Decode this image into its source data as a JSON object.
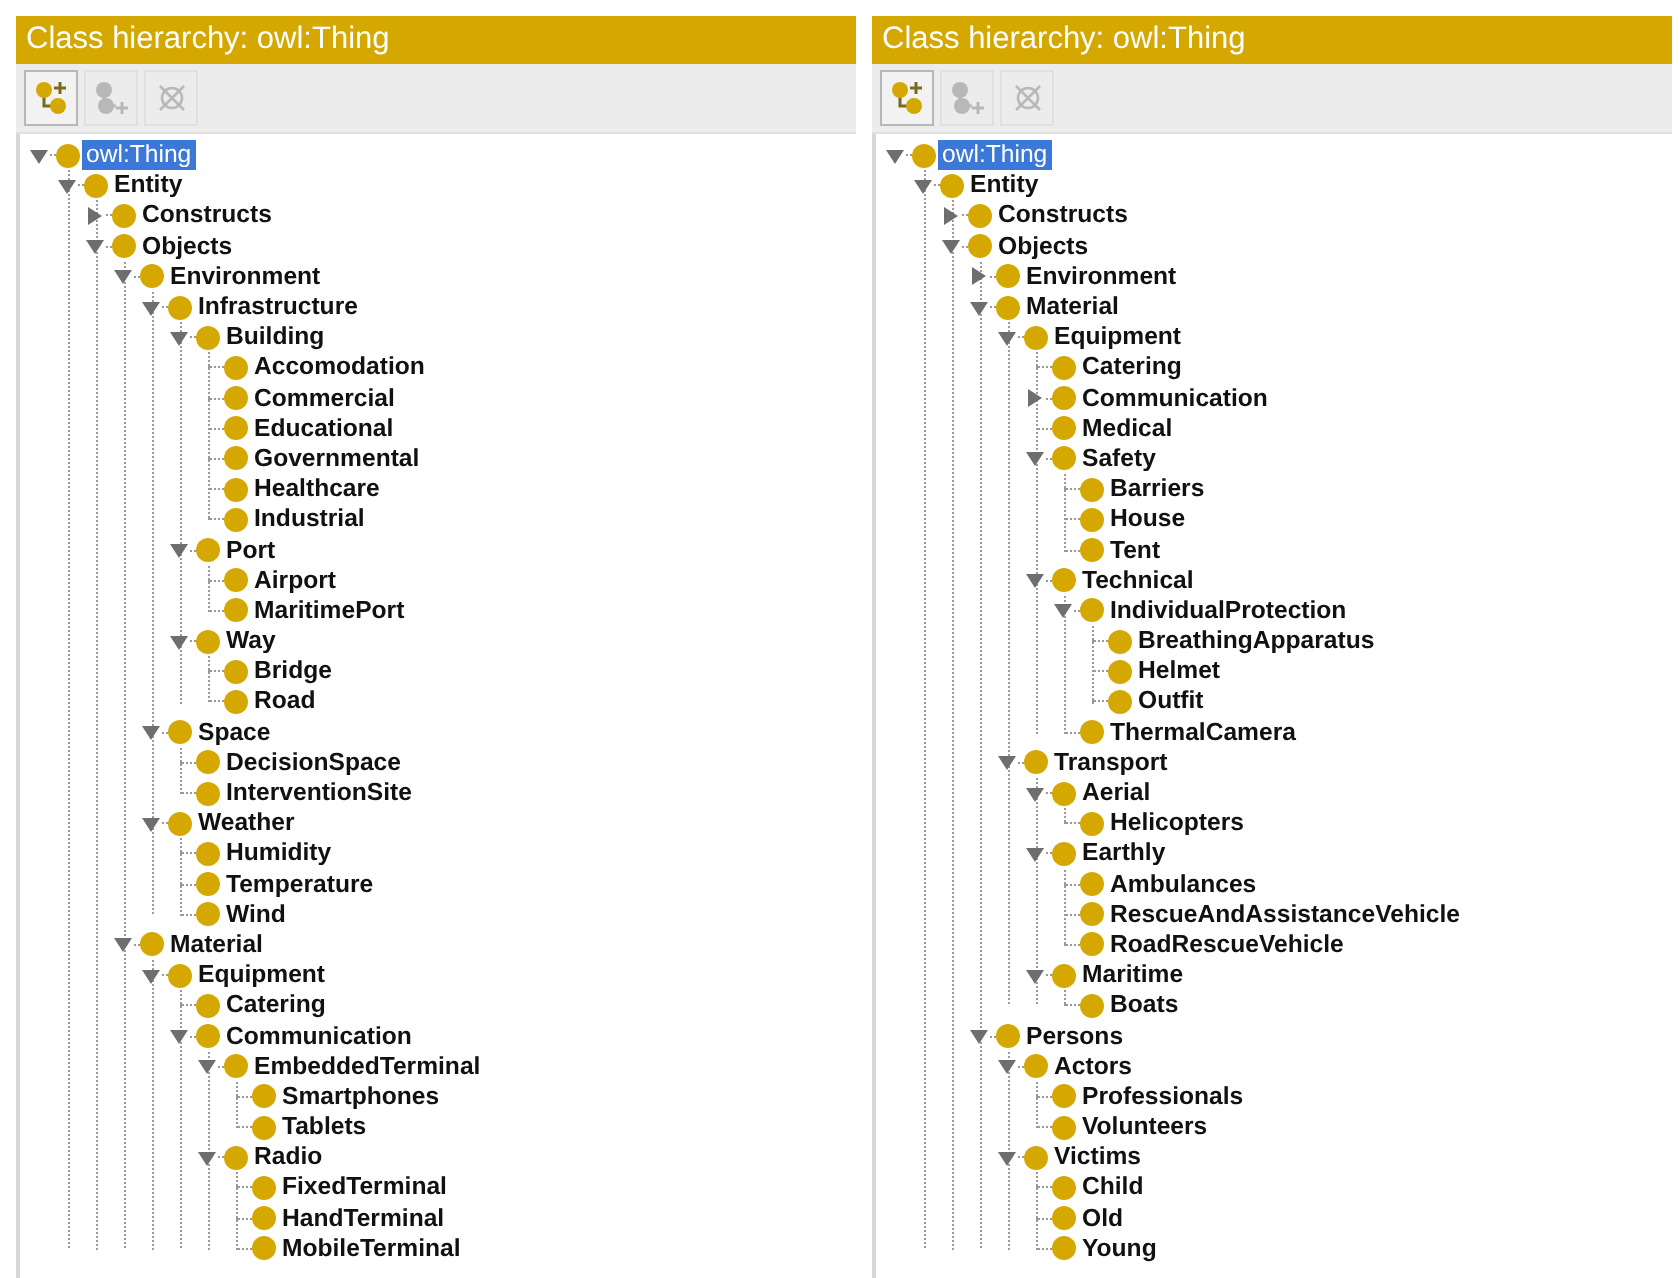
{
  "panels": [
    {
      "title": "Class hierarchy: owl:Thing",
      "toolbar": [
        {
          "kind": "add-subclass",
          "disabled": false
        },
        {
          "kind": "add-sibling",
          "disabled": true
        },
        {
          "kind": "delete",
          "disabled": true
        }
      ],
      "tree": {
        "label": "owl:Thing",
        "kind": "branch",
        "expanded": true,
        "selected": true,
        "children": [
          {
            "label": "Entity",
            "kind": "branch",
            "expanded": true,
            "selected": false,
            "children": [
              {
                "label": "Constructs",
                "kind": "branch",
                "expanded": false,
                "selected": false
              },
              {
                "label": "Objects",
                "kind": "branch",
                "expanded": true,
                "selected": false,
                "children": [
                  {
                    "label": "Environment",
                    "kind": "branch",
                    "expanded": true,
                    "selected": false,
                    "children": [
                      {
                        "label": "Infrastructure",
                        "kind": "branch",
                        "expanded": true,
                        "selected": false,
                        "children": [
                          {
                            "label": "Building",
                            "kind": "branch",
                            "expanded": true,
                            "selected": false,
                            "children": [
                              {
                                "label": "Accomodation",
                                "kind": "leaf",
                                "selected": false
                              },
                              {
                                "label": "Commercial",
                                "kind": "leaf",
                                "selected": false
                              },
                              {
                                "label": "Educational",
                                "kind": "leaf",
                                "selected": false
                              },
                              {
                                "label": "Governmental",
                                "kind": "leaf",
                                "selected": false
                              },
                              {
                                "label": "Healthcare",
                                "kind": "leaf",
                                "selected": false
                              },
                              {
                                "label": "Industrial",
                                "kind": "leaf",
                                "selected": false
                              }
                            ]
                          },
                          {
                            "label": "Port",
                            "kind": "branch",
                            "expanded": true,
                            "selected": false,
                            "children": [
                              {
                                "label": "Airport",
                                "kind": "leaf",
                                "selected": false
                              },
                              {
                                "label": "MaritimePort",
                                "kind": "leaf",
                                "selected": false
                              }
                            ]
                          },
                          {
                            "label": "Way",
                            "kind": "branch",
                            "expanded": true,
                            "selected": false,
                            "children": [
                              {
                                "label": "Bridge",
                                "kind": "leaf",
                                "selected": false
                              },
                              {
                                "label": "Road",
                                "kind": "leaf",
                                "selected": false
                              }
                            ]
                          }
                        ]
                      },
                      {
                        "label": "Space",
                        "kind": "branch",
                        "expanded": true,
                        "selected": false,
                        "children": [
                          {
                            "label": "DecisionSpace",
                            "kind": "leaf",
                            "selected": false
                          },
                          {
                            "label": "InterventionSite",
                            "kind": "leaf",
                            "selected": false
                          }
                        ]
                      },
                      {
                        "label": "Weather",
                        "kind": "branch",
                        "expanded": true,
                        "selected": false,
                        "children": [
                          {
                            "label": "Humidity",
                            "kind": "leaf",
                            "selected": false
                          },
                          {
                            "label": "Temperature",
                            "kind": "leaf",
                            "selected": false
                          },
                          {
                            "label": "Wind",
                            "kind": "leaf",
                            "selected": false
                          }
                        ]
                      }
                    ]
                  },
                  {
                    "label": "Material",
                    "kind": "branch",
                    "expanded": true,
                    "selected": false,
                    "children": [
                      {
                        "label": "Equipment",
                        "kind": "branch",
                        "expanded": true,
                        "selected": false,
                        "children": [
                          {
                            "label": "Catering",
                            "kind": "leaf",
                            "selected": false
                          },
                          {
                            "label": "Communication",
                            "kind": "branch",
                            "expanded": true,
                            "selected": false,
                            "children": [
                              {
                                "label": "EmbeddedTerminal",
                                "kind": "branch",
                                "expanded": true,
                                "selected": false,
                                "children": [
                                  {
                                    "label": "Smartphones",
                                    "kind": "leaf",
                                    "selected": false
                                  },
                                  {
                                    "label": "Tablets",
                                    "kind": "leaf",
                                    "selected": false
                                  }
                                ]
                              },
                              {
                                "label": "Radio",
                                "kind": "branch",
                                "expanded": true,
                                "selected": false,
                                "children": [
                                  {
                                    "label": "FixedTerminal",
                                    "kind": "leaf",
                                    "selected": false
                                  },
                                  {
                                    "label": "HandTerminal",
                                    "kind": "leaf",
                                    "selected": false
                                  },
                                  {
                                    "label": "MobileTerminal",
                                    "kind": "leaf",
                                    "selected": false
                                  }
                                ]
                              }
                            ]
                          }
                        ]
                      }
                    ]
                  }
                ]
              }
            ]
          }
        ]
      }
    },
    {
      "title": "Class hierarchy: owl:Thing",
      "toolbar": [
        {
          "kind": "add-subclass",
          "disabled": false
        },
        {
          "kind": "add-sibling",
          "disabled": true
        },
        {
          "kind": "delete",
          "disabled": true
        }
      ],
      "tree": {
        "label": "owl:Thing",
        "kind": "branch",
        "expanded": true,
        "selected": true,
        "children": [
          {
            "label": "Entity",
            "kind": "branch",
            "expanded": true,
            "selected": false,
            "children": [
              {
                "label": "Constructs",
                "kind": "branch",
                "expanded": false,
                "selected": false
              },
              {
                "label": "Objects",
                "kind": "branch",
                "expanded": true,
                "selected": false,
                "children": [
                  {
                    "label": "Environment",
                    "kind": "branch",
                    "expanded": false,
                    "selected": false
                  },
                  {
                    "label": "Material",
                    "kind": "branch",
                    "expanded": true,
                    "selected": false,
                    "children": [
                      {
                        "label": "Equipment",
                        "kind": "branch",
                        "expanded": true,
                        "selected": false,
                        "children": [
                          {
                            "label": "Catering",
                            "kind": "leaf",
                            "selected": false
                          },
                          {
                            "label": "Communication",
                            "kind": "branch",
                            "expanded": false,
                            "selected": false
                          },
                          {
                            "label": "Medical",
                            "kind": "leaf",
                            "selected": false
                          },
                          {
                            "label": "Safety",
                            "kind": "branch",
                            "expanded": true,
                            "selected": false,
                            "children": [
                              {
                                "label": "Barriers",
                                "kind": "leaf",
                                "selected": false
                              },
                              {
                                "label": "House",
                                "kind": "leaf",
                                "selected": false
                              },
                              {
                                "label": "Tent",
                                "kind": "leaf",
                                "selected": false
                              }
                            ]
                          },
                          {
                            "label": "Technical",
                            "kind": "branch",
                            "expanded": true,
                            "selected": false,
                            "children": [
                              {
                                "label": "IndividualProtection",
                                "kind": "branch",
                                "expanded": true,
                                "selected": false,
                                "children": [
                                  {
                                    "label": "BreathingApparatus",
                                    "kind": "leaf",
                                    "selected": false
                                  },
                                  {
                                    "label": "Helmet",
                                    "kind": "leaf",
                                    "selected": false
                                  },
                                  {
                                    "label": "Outfit",
                                    "kind": "leaf",
                                    "selected": false
                                  }
                                ]
                              },
                              {
                                "label": "ThermalCamera",
                                "kind": "leaf",
                                "selected": false
                              }
                            ]
                          }
                        ]
                      },
                      {
                        "label": "Transport",
                        "kind": "branch",
                        "expanded": true,
                        "selected": false,
                        "children": [
                          {
                            "label": "Aerial",
                            "kind": "branch",
                            "expanded": true,
                            "selected": false,
                            "children": [
                              {
                                "label": "Helicopters",
                                "kind": "leaf",
                                "selected": false
                              }
                            ]
                          },
                          {
                            "label": "Earthly",
                            "kind": "branch",
                            "expanded": true,
                            "selected": false,
                            "children": [
                              {
                                "label": "Ambulances",
                                "kind": "leaf",
                                "selected": false
                              },
                              {
                                "label": "RescueAndAssistanceVehicle",
                                "kind": "leaf",
                                "selected": false
                              },
                              {
                                "label": "RoadRescueVehicle",
                                "kind": "leaf",
                                "selected": false
                              }
                            ]
                          },
                          {
                            "label": "Maritime",
                            "kind": "branch",
                            "expanded": true,
                            "selected": false,
                            "children": [
                              {
                                "label": "Boats",
                                "kind": "leaf",
                                "selected": false
                              }
                            ]
                          }
                        ]
                      }
                    ]
                  },
                  {
                    "label": "Persons",
                    "kind": "branch",
                    "expanded": true,
                    "selected": false,
                    "children": [
                      {
                        "label": "Actors",
                        "kind": "branch",
                        "expanded": true,
                        "selected": false,
                        "children": [
                          {
                            "label": "Professionals",
                            "kind": "leaf",
                            "selected": false
                          },
                          {
                            "label": "Volunteers",
                            "kind": "leaf",
                            "selected": false
                          }
                        ]
                      },
                      {
                        "label": "Victims",
                        "kind": "branch",
                        "expanded": true,
                        "selected": false,
                        "children": [
                          {
                            "label": "Child",
                            "kind": "leaf",
                            "selected": false
                          },
                          {
                            "label": "Old",
                            "kind": "leaf",
                            "selected": false
                          },
                          {
                            "label": "Young",
                            "kind": "leaf",
                            "selected": false
                          }
                        ]
                      }
                    ]
                  }
                ]
              }
            ]
          }
        ]
      }
    }
  ]
}
